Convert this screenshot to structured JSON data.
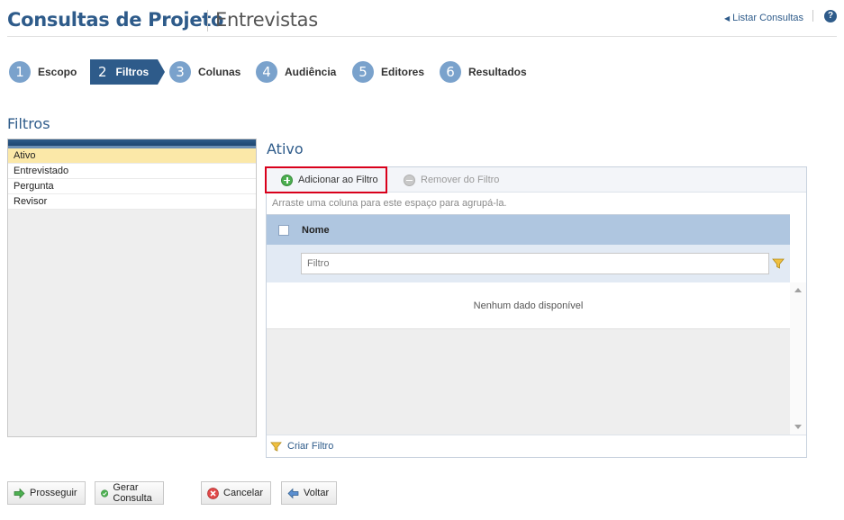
{
  "header": {
    "title": "Consultas de Projeto",
    "subtitle": "Entrevistas",
    "list_link": "Listar Consultas",
    "help_glyph": "?"
  },
  "wizard": {
    "steps": [
      {
        "num": "1",
        "label": "Escopo"
      },
      {
        "num": "2",
        "label": "Filtros",
        "active": true
      },
      {
        "num": "3",
        "label": "Colunas"
      },
      {
        "num": "4",
        "label": "Audiência"
      },
      {
        "num": "5",
        "label": "Editores"
      },
      {
        "num": "6",
        "label": "Resultados"
      }
    ]
  },
  "left": {
    "section_title": "Filtros",
    "items": [
      "Ativo",
      "Entrevistado",
      "Pergunta",
      "Revisor"
    ],
    "selected": "Ativo"
  },
  "right": {
    "title": "Ativo",
    "toolbar": {
      "add_label": "Adicionar ao Filtro",
      "remove_label": "Remover do Filtro"
    },
    "group_hint": "Arraste uma coluna para este espaço para agrupá-la.",
    "column_header": "Nome",
    "filter_placeholder": "Filtro",
    "no_data": "Nenhum dado disponível",
    "footer_link": "Criar Filtro"
  },
  "actions": {
    "proceed": "Prosseguir",
    "generate": "Gerar Consulta",
    "cancel": "Cancelar",
    "back": "Voltar"
  },
  "colors": {
    "brand": "#2e5b8a",
    "highlight_border": "#d9001b",
    "selected_row": "#fbe8a8",
    "grid_header": "#afc6e0"
  },
  "icons": {
    "add": "add-circle-icon",
    "remove": "remove-circle-icon",
    "filter": "funnel-icon",
    "proceed": "arrow-right-icon",
    "generate": "check-circle-icon",
    "cancel": "x-circle-icon",
    "back": "arrow-left-icon",
    "help": "help-icon"
  }
}
